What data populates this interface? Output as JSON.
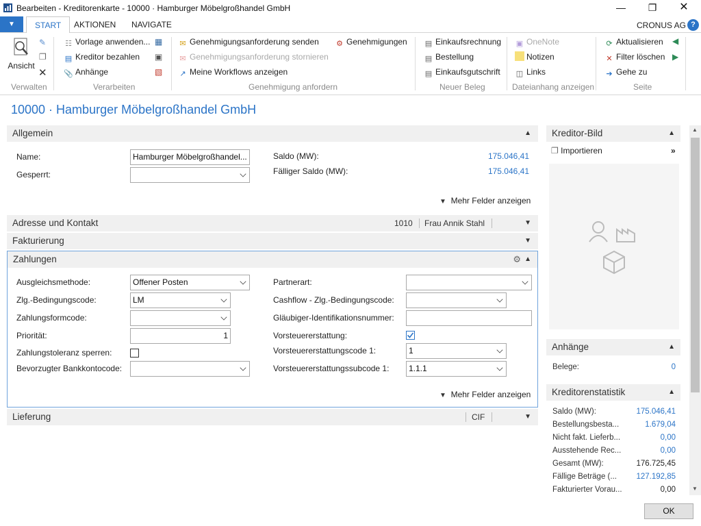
{
  "window": {
    "title": "Bearbeiten - Kreditorenkarte - 10000 · Hamburger Möbelgroßhandel GmbH"
  },
  "menu": {
    "file_glyph": "▼",
    "tabs": [
      "START",
      "AKTIONEN",
      "NAVIGATE"
    ],
    "company": "CRONUS AG",
    "help": "?"
  },
  "ribbon": {
    "verwalten": {
      "label": "Verwalten",
      "ansicht": "Ansicht"
    },
    "verarbeiten": {
      "label": "Verarbeiten",
      "vorlage": "Vorlage anwenden...",
      "bezahlen": "Kreditor bezahlen",
      "anhaenge": "Anhänge"
    },
    "genehmigung": {
      "label": "Genehmigung anfordern",
      "senden": "Genehmigungsanforderung senden",
      "stornieren": "Genehmigungsanforderung stornieren",
      "workflows": "Meine Workflows anzeigen",
      "genehmigungen": "Genehmigungen"
    },
    "beleg": {
      "label": "Neuer Beleg",
      "einkaufsrechnung": "Einkaufsrechnung",
      "bestellung": "Bestellung",
      "gutschrift": "Einkaufsgutschrift"
    },
    "dateianhang": {
      "label": "Dateianhang anzeigen",
      "onenote": "OneNote",
      "notizen": "Notizen",
      "links": "Links"
    },
    "seite": {
      "label": "Seite",
      "aktualisieren": "Aktualisieren",
      "filter": "Filter löschen",
      "gehe": "Gehe zu"
    }
  },
  "page": {
    "title": "10000 · Hamburger Möbelgroßhandel GmbH"
  },
  "allgemein": {
    "title": "Allgemein",
    "name_label": "Name:",
    "name_value": "Hamburger Möbelgroßhandel...",
    "gesperrt_label": "Gesperrt:",
    "gesperrt_value": "",
    "saldo_label": "Saldo (MW):",
    "saldo_value": "175.046,41",
    "faellig_label": "Fälliger Saldo (MW):",
    "faellig_value": "175.046,41",
    "more": "Mehr Felder anzeigen"
  },
  "adresse": {
    "title": "Adresse und Kontakt",
    "code": "1010",
    "contact": "Frau Annik Stahl"
  },
  "fakturierung": {
    "title": "Fakturierung"
  },
  "zahlungen": {
    "title": "Zahlungen",
    "ausgleich_label": "Ausgleichsmethode:",
    "ausgleich_value": "Offener Posten",
    "bedingung_label": "Zlg.-Bedingungscode:",
    "bedingung_value": "LM",
    "zahlungsform_label": "Zahlungsformcode:",
    "zahlungsform_value": "",
    "prioritaet_label": "Priorität:",
    "prioritaet_value": "1",
    "toleranz_label": "Zahlungstoleranz sperren:",
    "bankkonto_label": "Bevorzugter Bankkontocode:",
    "bankkonto_value": "",
    "partnerart_label": "Partnerart:",
    "partnerart_value": "",
    "cashflow_label": "Cashflow - Zlg.-Bedingungscode:",
    "cashflow_value": "",
    "glaeubiger_label": "Gläubiger-Identifikationsnummer:",
    "glaeubiger_value": "",
    "vorsteuer_label": "Vorsteuererstattung:",
    "vorsteuer_checked": true,
    "vcode_label": "Vorsteuererstattungscode 1:",
    "vcode_value": "1",
    "vsub_label": "Vorsteuererstattungssubcode 1:",
    "vsub_value": "1.1.1",
    "more": "Mehr Felder anzeigen"
  },
  "lieferung": {
    "title": "Lieferung",
    "code": "CIF"
  },
  "factbox": {
    "bild": {
      "title": "Kreditor-Bild",
      "importieren": "Importieren"
    },
    "anhaenge": {
      "title": "Anhänge",
      "belege_label": "Belege:",
      "belege_value": "0"
    },
    "statistik": {
      "title": "Kreditorenstatistik",
      "rows": [
        {
          "label": "Saldo (MW):",
          "value": "175.046,41",
          "link": true
        },
        {
          "label": "Bestellungsbesta...",
          "value": "1.679,04",
          "link": true
        },
        {
          "label": "Nicht fakt. Lieferb...",
          "value": "0,00",
          "link": true
        },
        {
          "label": "Ausstehende Rec...",
          "value": "0,00",
          "link": true
        },
        {
          "label": "Gesamt (MW):",
          "value": "176.725,45",
          "link": false
        },
        {
          "label": "Fällige Beträge (...",
          "value": "127.192,85",
          "link": true
        },
        {
          "label": "Fakturierter Vorau...",
          "value": "0,00",
          "link": false
        }
      ]
    }
  },
  "buttons": {
    "ok": "OK"
  },
  "colors": {
    "accent": "#2b74c7",
    "section_bg": "#f0f0f0"
  }
}
